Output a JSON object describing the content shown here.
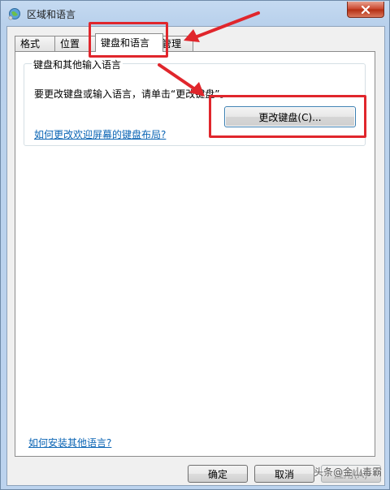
{
  "window": {
    "title": "区域和语言"
  },
  "tabs": [
    {
      "label": "格式"
    },
    {
      "label": "位置"
    },
    {
      "label": "键盘和语言"
    },
    {
      "label": "管理"
    }
  ],
  "keyboard_group": {
    "title": "键盘和其他输入语言",
    "description": "要更改键盘或输入语言，请单击“更改键盘”。",
    "change_button": "更改键盘(C)...",
    "layout_link": "如何更改欢迎屏幕的键盘布局?"
  },
  "install_link": "如何安装其他语言?",
  "footer": {
    "ok": "确定",
    "cancel": "取消",
    "apply": "应用(A)"
  },
  "watermark": "头条@金山毒霸",
  "colors": {
    "annotation": "#e0262c",
    "link": "#0a64b4"
  }
}
